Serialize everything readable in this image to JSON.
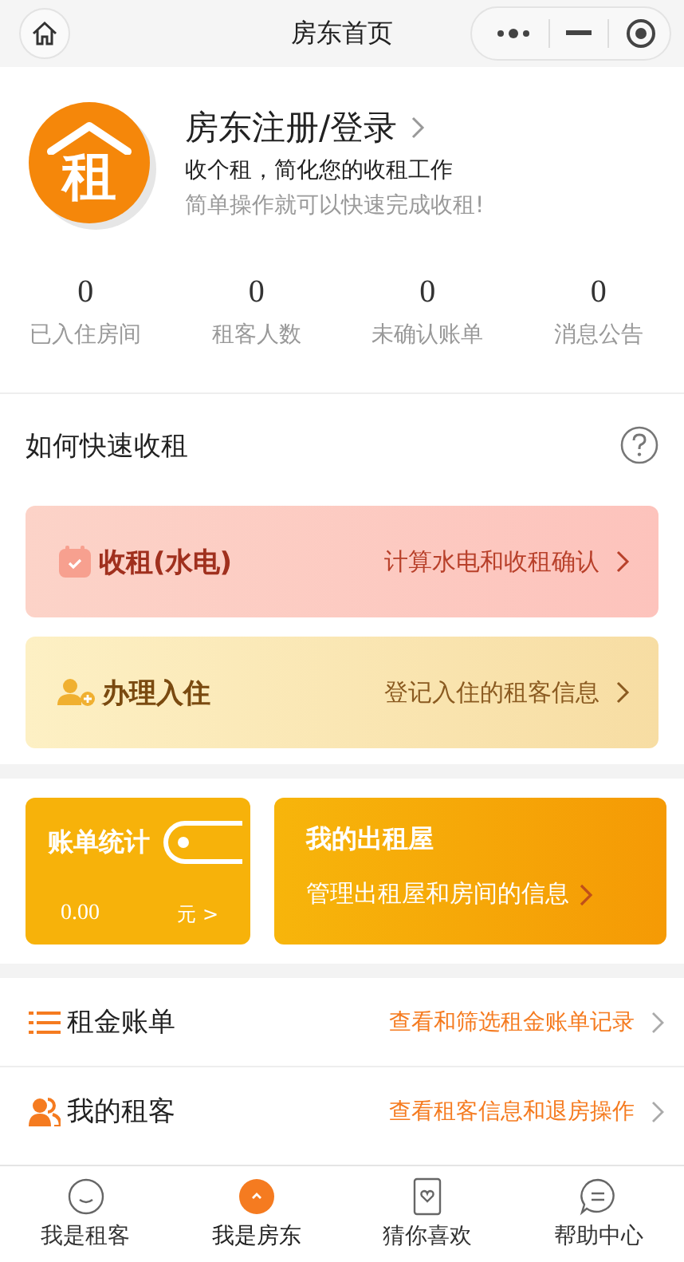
{
  "nav_bar": {
    "title": "房东首页"
  },
  "profile": {
    "logo_text": "租",
    "title": "房东注册/登录",
    "subtitle": "收个租，简化您的收租工作",
    "hint": "简单操作就可以快速完成收租!"
  },
  "stats": [
    {
      "value": "0",
      "label": "已入住房间"
    },
    {
      "value": "0",
      "label": "租客人数"
    },
    {
      "value": "0",
      "label": "未确认账单"
    },
    {
      "value": "0",
      "label": "消息公告"
    }
  ],
  "guide": {
    "title": "如何快速收租",
    "cards": [
      {
        "kind": "rent",
        "title": "收租(水电)",
        "desc": "计算水电和收租确认"
      },
      {
        "kind": "checkin",
        "title": "办理入住",
        "desc": "登记入住的租客信息"
      }
    ]
  },
  "tiles": {
    "bill": {
      "title": "账单统计",
      "amount": "0.00",
      "unit": "元 >"
    },
    "rooms": {
      "title": "我的出租屋",
      "desc": "管理出租屋和房间的信息"
    }
  },
  "menu": [
    {
      "kind": "bills",
      "label": "租金账单",
      "desc": "查看和筛选租金账单记录"
    },
    {
      "kind": "tenants",
      "label": "我的租客",
      "desc": "查看租客信息和退房操作"
    }
  ],
  "tab_bar": [
    {
      "kind": "smile",
      "label": "我是租客",
      "selected": false
    },
    {
      "kind": "up",
      "label": "我是房东",
      "selected": true
    },
    {
      "kind": "heart",
      "label": "猜你喜欢",
      "selected": false
    },
    {
      "kind": "chat",
      "label": "帮助中心",
      "selected": false
    }
  ]
}
